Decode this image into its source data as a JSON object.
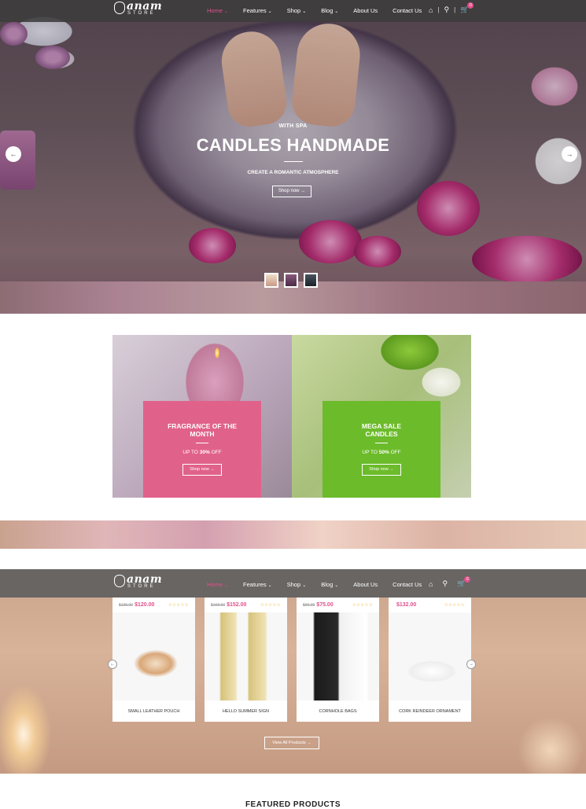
{
  "brand": {
    "name": "anam",
    "sub": "STORE"
  },
  "nav": {
    "items": [
      {
        "label": "Home",
        "caret": "⌄"
      },
      {
        "label": "Features",
        "caret": "⌄"
      },
      {
        "label": "Shop",
        "caret": "⌄"
      },
      {
        "label": "Blog",
        "caret": "⌄"
      },
      {
        "label": "About Us",
        "caret": ""
      },
      {
        "label": "Contact Us",
        "caret": ""
      }
    ],
    "cart_count": "0",
    "icons": [
      "account-icon",
      "search-icon",
      "cart-icon"
    ]
  },
  "hero": {
    "kicker": "WITH SPA",
    "title": "CANDLES HANDMADE",
    "subtitle": "CREATE A ROMANTIC ATMOSPHERE",
    "button": "Shop now →",
    "prev": "←",
    "next": "→"
  },
  "banners": [
    {
      "title": "FRAGRANCE OF THE MONTH",
      "offer_prefix": "UP TO ",
      "offer_value": "30%",
      "offer_suffix": " OFF",
      "button": "Shop now →",
      "color": "#e0628a"
    },
    {
      "title": "MEGA SALE CANDLES",
      "offer_prefix": "UP TO ",
      "offer_value": "50%",
      "offer_suffix": " OFF",
      "button": "Shop now →",
      "color": "#6cbb2b"
    }
  ],
  "products": {
    "items": [
      {
        "old_price": "$135.00",
        "price": "$120.00",
        "name": "SMALL LEATHER POUCH",
        "stars": "☆☆☆☆☆"
      },
      {
        "old_price": "$168.00",
        "price": "$152.00",
        "name": "HELLO SUMMER SIGN",
        "stars": "☆☆☆☆☆"
      },
      {
        "old_price": "$90.00",
        "price": "$75.00",
        "name": "CORNHOLE BAGS",
        "stars": "☆☆☆☆☆"
      },
      {
        "old_price": "",
        "price": "$132.00",
        "name": "CORK REINDEER ORNAMENT",
        "stars": "☆☆☆☆☆"
      }
    ],
    "view_all": "View All Products →",
    "prev": "←",
    "next": "→"
  },
  "featured_heading": "FEATURED PRODUCTS",
  "colors": {
    "accent": "#e0508a",
    "pink_banner": "#e0628a",
    "green_banner": "#6cbb2b"
  }
}
